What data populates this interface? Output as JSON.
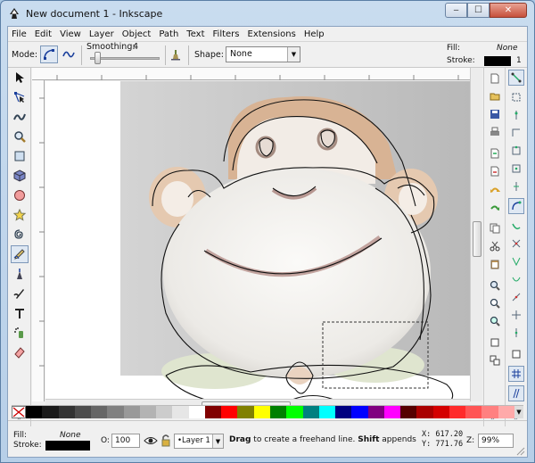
{
  "window": {
    "title": "New document 1 - Inkscape",
    "minimize": "‒",
    "maximize": "☐",
    "close": "✕"
  },
  "menu": [
    "File",
    "Edit",
    "View",
    "Layer",
    "Object",
    "Path",
    "Text",
    "Filters",
    "Extensions",
    "Help"
  ],
  "tool_controls": {
    "mode_label": "Mode:",
    "smoothing_label": "Smoothing:",
    "smoothing_value": "4",
    "shape_label": "Shape:",
    "shape_value": "None",
    "fill_label": "Fill:",
    "fill_value": "None",
    "stroke_label": "Stroke:",
    "stroke_width": "1"
  },
  "statusbar": {
    "fill_label": "Fill:",
    "fill_value": "None",
    "stroke_label": "Stroke:",
    "opacity_label": "O:",
    "opacity_value": "100",
    "layer_value": "•Layer 1",
    "message_bold1": "Drag",
    "message_text1": " to create a freehand line. ",
    "message_bold2": "Shift",
    "message_text2": " appends to selec",
    "x_label": "X:",
    "x_value": "617.20",
    "y_label": "Y:",
    "y_value": "771.76",
    "zoom_label": "Z:",
    "zoom_value": "99%"
  },
  "palette": [
    "#000000",
    "#1a1a1a",
    "#333333",
    "#4d4d4d",
    "#666666",
    "#808080",
    "#999999",
    "#b3b3b3",
    "#cccccc",
    "#e6e6e6",
    "#ffffff",
    "#800000",
    "#ff0000",
    "#808000",
    "#ffff00",
    "#008000",
    "#00ff00",
    "#008080",
    "#00ffff",
    "#000080",
    "#0000ff",
    "#800080",
    "#ff00ff",
    "#550000",
    "#aa0000",
    "#d40000",
    "#ff2a2a",
    "#ff5555",
    "#ff8080",
    "#ffaaaa"
  ],
  "colors": {
    "accent": "#7d98b9",
    "canvas_bg": "#ffffff",
    "photo_bg": "#c9c9c9"
  }
}
